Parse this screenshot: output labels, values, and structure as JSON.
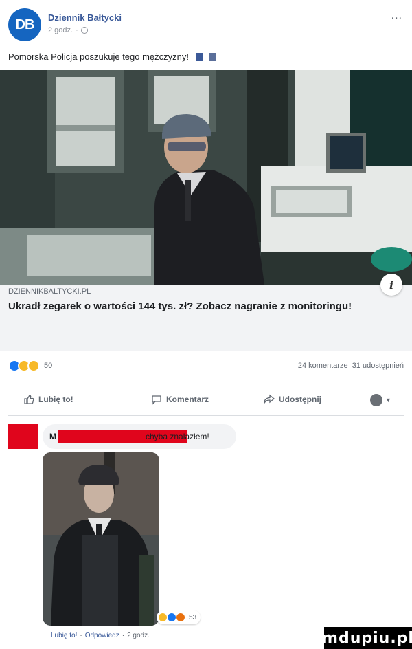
{
  "post": {
    "page_avatar_text": "DB",
    "page_name": "Dziennik Bałtycki",
    "time": "2 godz.",
    "audience_icon": "globe-icon",
    "more_label": "...",
    "text": "Pomorska Policja poszukuje tego mężczyzny!"
  },
  "link_preview": {
    "domain": "DZIENNIKBALTYCKI.PL",
    "headline": "Ukradł zegarek o wartości 144 tys. zł? Zobacz nagranie z monitoringu!",
    "info_icon": "i"
  },
  "reactions": {
    "count": "50",
    "comments": "24 komentarze",
    "shares": "31 udostępnień"
  },
  "actions": {
    "like": "Lubię to!",
    "comment": "Komentarz",
    "share": "Udostępnij"
  },
  "comment": {
    "author_initial": "M",
    "text": "chyba znalazłem!",
    "reaction_count": "53",
    "like": "Lubię to!",
    "reply": "Odpowiedz",
    "time": "2 godz."
  },
  "watermark": "mdupiu.pl",
  "colors": {
    "brand": "#1565c0",
    "link": "#385898",
    "redaction": "#e0051c"
  }
}
